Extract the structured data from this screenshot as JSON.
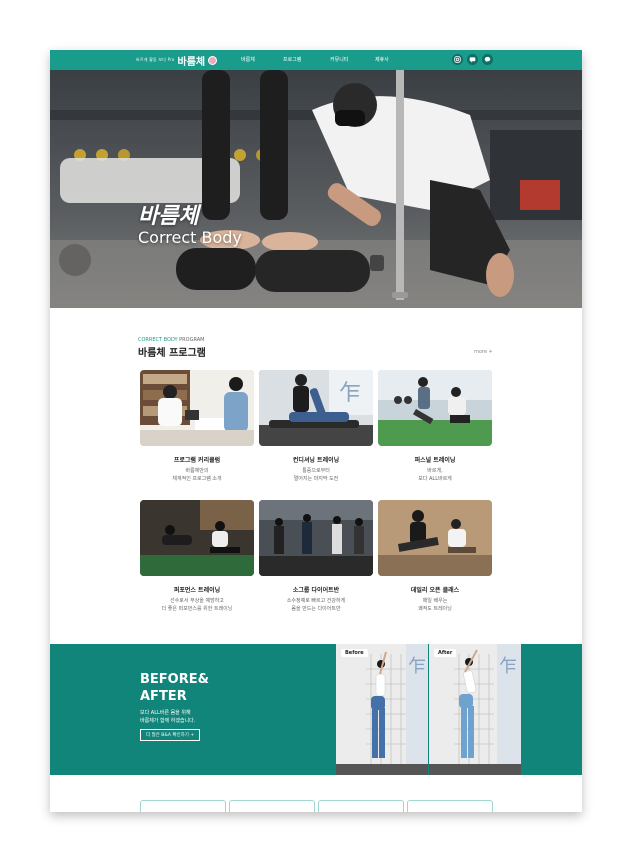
{
  "header": {
    "logo_small": "바르게 활동 보다 Pro",
    "logo_big": "바름체",
    "nav": [
      "바름체",
      "프로그램",
      "커뮤니티",
      "제휴사"
    ],
    "icons": [
      "instagram-icon",
      "chat-icon",
      "kakao-icon"
    ]
  },
  "hero": {
    "title_ko": "바름체",
    "title_en": "Correct Body"
  },
  "program": {
    "label_accent": "CORRECT BODY",
    "label_rest": " PROGRAM",
    "title": "바름체 프로그램",
    "more": "more +",
    "cards": [
      {
        "title": "프로그램 커리큘럼",
        "desc1": "바름체만의",
        "desc2": "체계적인 프로그램 소개"
      },
      {
        "title": "컨디셔닝 트레이닝",
        "desc1": "통증으로부터",
        "desc2": "멀어지는 마지막 도전"
      },
      {
        "title": "퍼스널 트레이닝",
        "desc1": "바르게,",
        "desc2": "보다 ALL바르게"
      },
      {
        "title": "퍼포먼스 트레이닝",
        "desc1": "선수로서 부상을 예방하고",
        "desc2": "더 좋은 퍼포먼스를 위한 트레이닝"
      },
      {
        "title": "소그룹 다이어트반",
        "desc1": "소수정예로 빠르고 건강하게",
        "desc2": "몸을 만드는 다이어트반"
      },
      {
        "title": "데일리 오픈 클래스",
        "desc1": "매일 배우는",
        "desc2": "쾌적도 트레이닝"
      }
    ]
  },
  "before_after": {
    "title1": "BEFORE&",
    "title2": "AFTER",
    "desc1": "보다 ALL바른 몸을 위해",
    "desc2": "바름체가 함께 하겠습니다.",
    "button": "더 많은 B&A 확인하기 +",
    "tag_before": "Before",
    "tag_after": "After"
  },
  "colors": {
    "brand": "#1a9c8c",
    "brand_dark": "#12857a"
  }
}
